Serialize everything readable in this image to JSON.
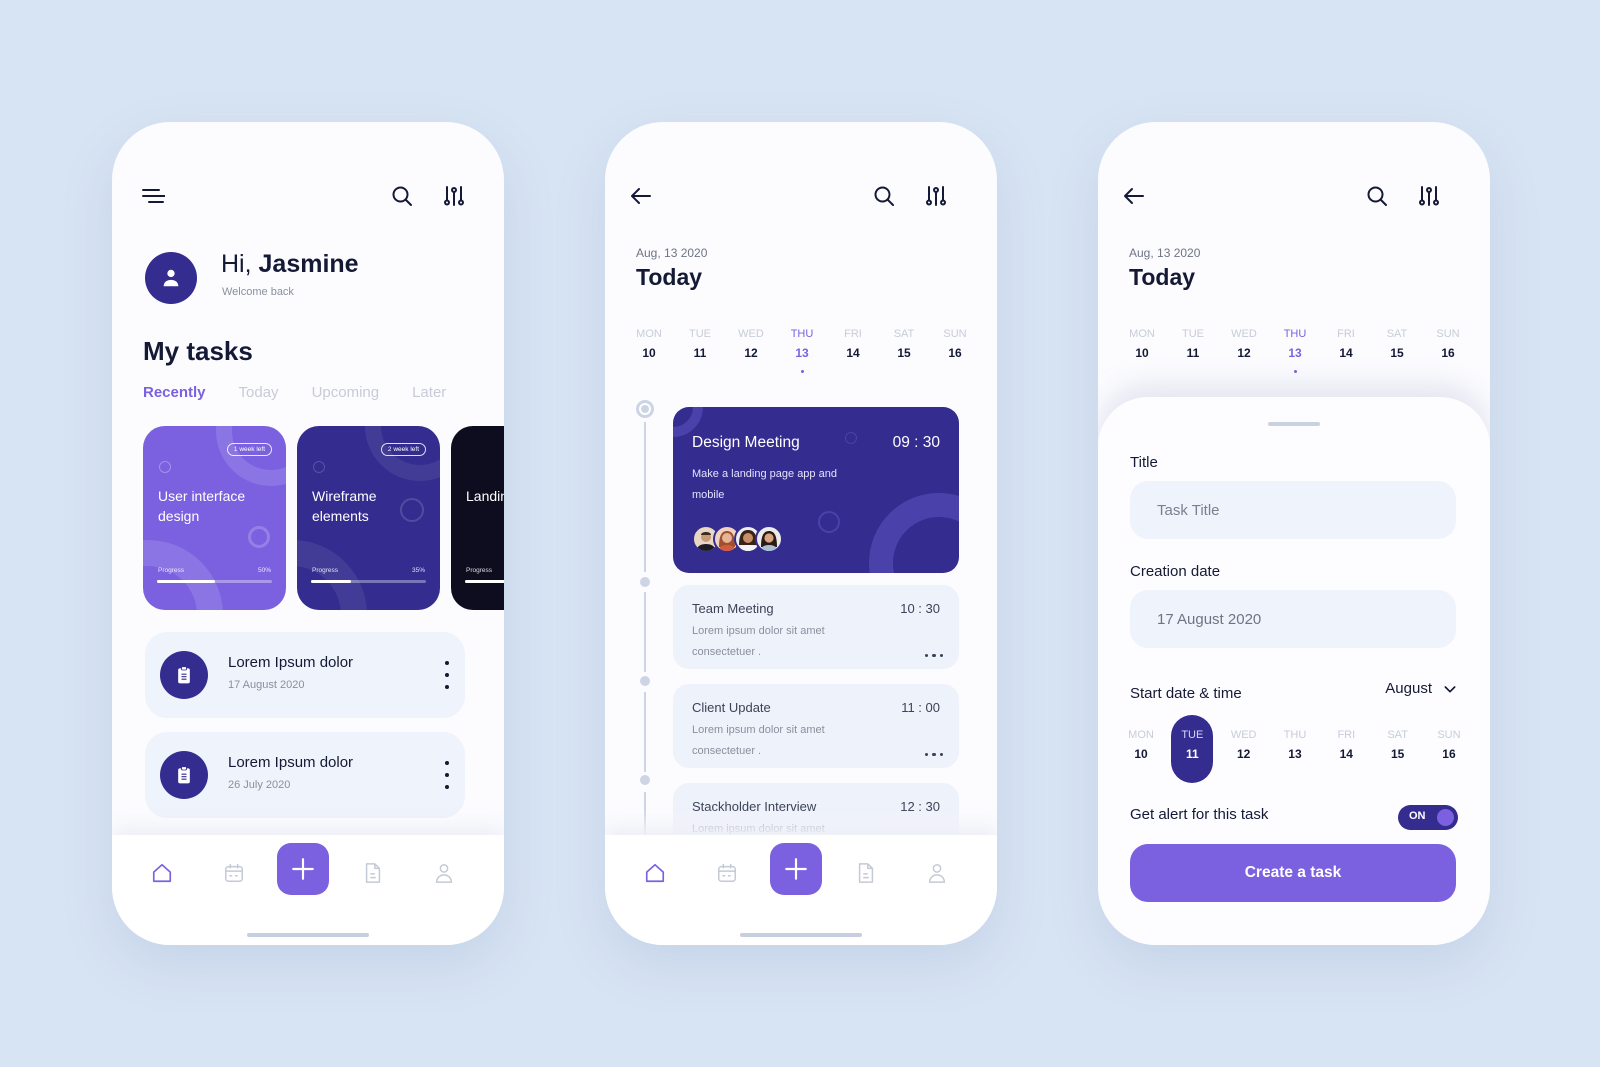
{
  "colors": {
    "background": "#d7e4f3",
    "primary_dark": "#342c8f",
    "accent": "#7b61e0",
    "text_dark": "#141936",
    "muted": "#8a8f9e"
  },
  "phone1": {
    "header": {
      "menu_icon": "menu-icon",
      "search_icon": "search-icon",
      "filter_icon": "sliders-icon"
    },
    "greeting": {
      "hi": "Hi,",
      "name": "Jasmine",
      "subtitle": "Welcome back"
    },
    "section_title": "My tasks",
    "tabs": [
      {
        "label": "Recently",
        "active": true
      },
      {
        "label": "Today",
        "active": false
      },
      {
        "label": "Upcoming",
        "active": false
      },
      {
        "label": "Later",
        "active": false
      }
    ],
    "project_cards": [
      {
        "title": "User interface design",
        "badge": "1 week left",
        "progress_label": "Progress",
        "progress_pct": 50,
        "progress_text": "50%",
        "color": "#7b61e0"
      },
      {
        "title": "Wireframe elements",
        "badge": "2 week left",
        "progress_label": "Progress",
        "progress_pct": 35,
        "progress_text": "35%",
        "color": "#342c8f"
      },
      {
        "title": "Landing design",
        "badge": "",
        "progress_label": "Progress",
        "progress_pct": 40,
        "progress_text": "",
        "color": "#0d0d1f"
      }
    ],
    "task_list": [
      {
        "title": "Lorem Ipsum dolor",
        "date": "17 August 2020",
        "icon": "clipboard-icon"
      },
      {
        "title": "Lorem Ipsum dolor",
        "date": "26 July 2020",
        "icon": "clipboard-icon"
      }
    ]
  },
  "bottom_nav": {
    "items": [
      "home",
      "calendar",
      "add",
      "document",
      "profile"
    ],
    "active": "home"
  },
  "week": [
    {
      "day": "MON",
      "date": "10"
    },
    {
      "day": "TUE",
      "date": "11"
    },
    {
      "day": "WED",
      "date": "12"
    },
    {
      "day": "THU",
      "date": "13"
    },
    {
      "day": "FRI",
      "date": "14"
    },
    {
      "day": "SAT",
      "date": "15"
    },
    {
      "day": "SUN",
      "date": "16"
    }
  ],
  "phone2": {
    "date_label": "Aug, 13 2020",
    "title": "Today",
    "active_day_index": 3,
    "events": [
      {
        "title": "Design Meeting",
        "time": "09 : 30",
        "desc": "Make a landing page app and mobile",
        "highlight": true,
        "attendees": 4
      },
      {
        "title": "Team Meeting",
        "time": "10 : 30",
        "desc": "Lorem ipsum dolor sit amet consectetuer ."
      },
      {
        "title": "Client Update",
        "time": "11 : 00",
        "desc": "Lorem ipsum dolor sit amet consectetuer ."
      },
      {
        "title": "Stackholder Interview",
        "time": "12 : 30",
        "desc": "Lorem ipsum dolor sit amet"
      }
    ]
  },
  "phone3": {
    "date_label": "Aug, 13 2020",
    "title": "Today",
    "active_day_index": 3,
    "form": {
      "title_label": "Title",
      "title_placeholder": "Task Title",
      "creation_label": "Creation date",
      "creation_value": "17 August 2020",
      "start_label": "Start date & time",
      "month": "August",
      "selected_day_index": 1,
      "alert_label": "Get alert for this task",
      "alert_state": "ON",
      "submit_label": "Create a task"
    }
  }
}
